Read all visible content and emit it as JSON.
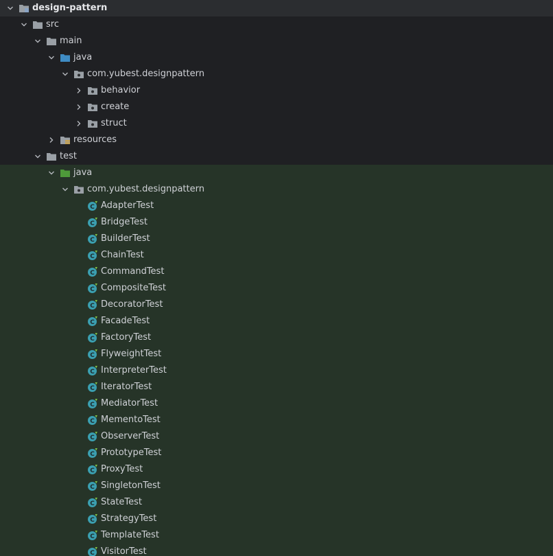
{
  "colors": {
    "folder": "#9aa0a6",
    "source_root": "#3f8cc4",
    "test_root": "#4e9a3a",
    "class_icon": "#3b9fb0",
    "resources_stripe": "#d1a23a",
    "root_module": "#8aa4c4"
  },
  "tree": [
    {
      "label": "design-pattern",
      "depth": 0,
      "expanded": true,
      "icon": "module-icon",
      "bold": true,
      "zone": "root"
    },
    {
      "label": "src",
      "depth": 1,
      "expanded": true,
      "icon": "folder-icon",
      "zone": "main"
    },
    {
      "label": "main",
      "depth": 2,
      "expanded": true,
      "icon": "folder-icon",
      "zone": "main"
    },
    {
      "label": "java",
      "depth": 3,
      "expanded": true,
      "icon": "source-root-icon",
      "zone": "main"
    },
    {
      "label": "com.yubest.designpattern",
      "depth": 4,
      "expanded": true,
      "icon": "package-icon",
      "zone": "main"
    },
    {
      "label": "behavior",
      "depth": 5,
      "expanded": false,
      "icon": "package-icon",
      "zone": "main"
    },
    {
      "label": "create",
      "depth": 5,
      "expanded": false,
      "icon": "package-icon",
      "zone": "main"
    },
    {
      "label": "struct",
      "depth": 5,
      "expanded": false,
      "icon": "package-icon",
      "zone": "main"
    },
    {
      "label": "resources",
      "depth": 3,
      "expanded": false,
      "icon": "resources-icon",
      "zone": "main"
    },
    {
      "label": "test",
      "depth": 2,
      "expanded": true,
      "icon": "folder-icon",
      "zone": "main"
    },
    {
      "label": "java",
      "depth": 3,
      "expanded": true,
      "icon": "test-root-icon",
      "zone": "test"
    },
    {
      "label": "com.yubest.designpattern",
      "depth": 4,
      "expanded": true,
      "icon": "package-icon",
      "zone": "test"
    },
    {
      "label": "AdapterTest",
      "depth": 5,
      "icon": "test-class-icon",
      "zone": "test"
    },
    {
      "label": "BridgeTest",
      "depth": 5,
      "icon": "test-class-icon",
      "zone": "test"
    },
    {
      "label": "BuilderTest",
      "depth": 5,
      "icon": "test-class-icon",
      "zone": "test"
    },
    {
      "label": "ChainTest",
      "depth": 5,
      "icon": "test-class-icon",
      "zone": "test"
    },
    {
      "label": "CommandTest",
      "depth": 5,
      "icon": "test-class-icon",
      "zone": "test"
    },
    {
      "label": "CompositeTest",
      "depth": 5,
      "icon": "test-class-icon",
      "zone": "test"
    },
    {
      "label": "DecoratorTest",
      "depth": 5,
      "icon": "test-class-icon",
      "zone": "test"
    },
    {
      "label": "FacadeTest",
      "depth": 5,
      "icon": "test-class-icon",
      "zone": "test"
    },
    {
      "label": "FactoryTest",
      "depth": 5,
      "icon": "test-class-icon",
      "zone": "test"
    },
    {
      "label": "FlyweightTest",
      "depth": 5,
      "icon": "test-class-icon",
      "zone": "test"
    },
    {
      "label": "InterpreterTest",
      "depth": 5,
      "icon": "test-class-icon",
      "zone": "test"
    },
    {
      "label": "IteratorTest",
      "depth": 5,
      "icon": "test-class-icon",
      "zone": "test"
    },
    {
      "label": "MediatorTest",
      "depth": 5,
      "icon": "test-class-icon",
      "zone": "test"
    },
    {
      "label": "MementoTest",
      "depth": 5,
      "icon": "test-class-icon",
      "zone": "test"
    },
    {
      "label": "ObserverTest",
      "depth": 5,
      "icon": "test-class-icon",
      "zone": "test"
    },
    {
      "label": "PrototypeTest",
      "depth": 5,
      "icon": "test-class-icon",
      "zone": "test"
    },
    {
      "label": "ProxyTest",
      "depth": 5,
      "icon": "test-class-icon",
      "zone": "test"
    },
    {
      "label": "SingletonTest",
      "depth": 5,
      "icon": "test-class-icon",
      "zone": "test"
    },
    {
      "label": "StateTest",
      "depth": 5,
      "icon": "test-class-icon",
      "zone": "test"
    },
    {
      "label": "StrategyTest",
      "depth": 5,
      "icon": "test-class-icon",
      "zone": "test"
    },
    {
      "label": "TemplateTest",
      "depth": 5,
      "icon": "test-class-icon",
      "zone": "test"
    },
    {
      "label": "VisitorTest",
      "depth": 5,
      "icon": "test-class-icon",
      "zone": "test"
    }
  ]
}
